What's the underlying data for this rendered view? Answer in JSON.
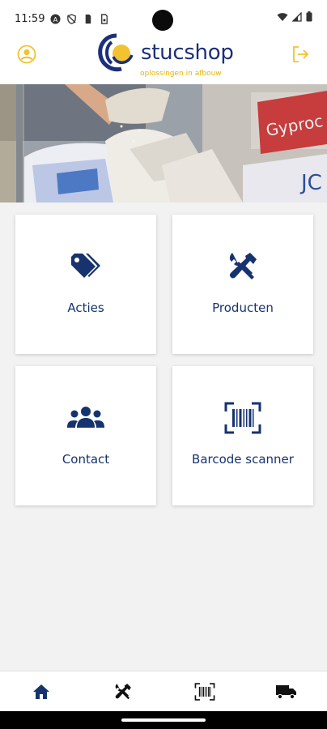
{
  "status_bar": {
    "time": "11:59",
    "icons": [
      "a-icon",
      "shield-off-icon",
      "sim-icon",
      "sd-card-icon",
      "wifi-icon",
      "signal-icon",
      "battery-icon"
    ]
  },
  "header": {
    "profile_icon": "account-circle-icon",
    "logout_icon": "logout-icon",
    "logo_text": "stucshop",
    "logo_tagline": "oplossingen in afbouw",
    "accent_color": "#f2c230",
    "brand_color": "#1b2f7a"
  },
  "hero": {
    "image_subject": "hands-pouring-plaster-from-bags"
  },
  "tiles": [
    {
      "label": "Acties",
      "icon": "tags-icon"
    },
    {
      "label": "Producten",
      "icon": "tools-icon"
    },
    {
      "label": "Contact",
      "icon": "users-icon"
    },
    {
      "label": "Barcode scanner",
      "icon": "barcode-scanner-icon"
    }
  ],
  "bottom_nav": [
    {
      "icon": "home-icon",
      "active": true
    },
    {
      "icon": "tools-icon",
      "active": false
    },
    {
      "icon": "barcode-icon",
      "active": false
    },
    {
      "icon": "truck-icon",
      "active": false
    }
  ]
}
